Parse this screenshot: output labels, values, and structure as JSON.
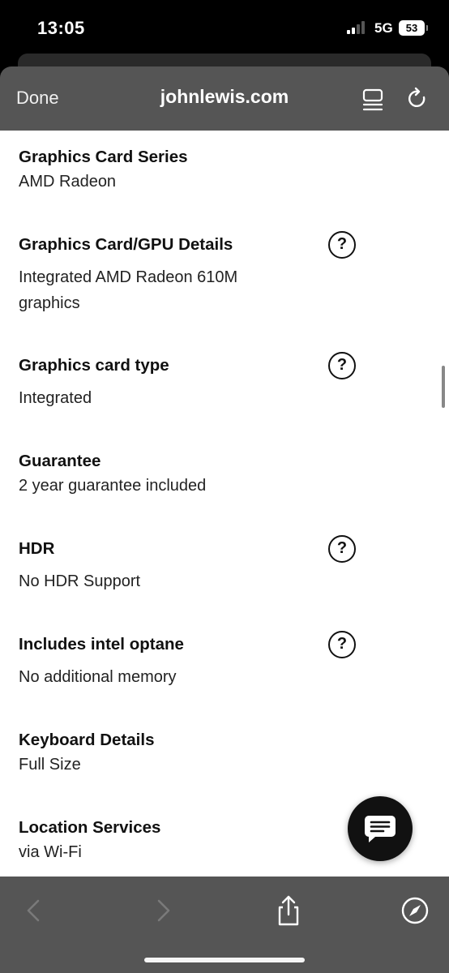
{
  "status_bar": {
    "time": "13:05",
    "network": "5G",
    "battery": "53"
  },
  "browser": {
    "done_label": "Done",
    "url": "johnlewis.com",
    "icons": {
      "reader": "reader-icon",
      "reload": "reload-icon"
    }
  },
  "specs": [
    {
      "title": "Graphics Card Series",
      "value": "AMD Radeon",
      "has_help": false
    },
    {
      "title": "Graphics Card/GPU Details",
      "value_lines": [
        "Integrated AMD Radeon 610M",
        "graphics"
      ],
      "has_help": true
    },
    {
      "title": "Graphics card type",
      "value": "Integrated",
      "has_help": true
    },
    {
      "title": "Guarantee",
      "value": "2 year guarantee included",
      "has_help": false
    },
    {
      "title": "HDR",
      "value": "No HDR Support",
      "has_help": true
    },
    {
      "title": "Includes intel optane",
      "value": "No additional memory",
      "has_help": true
    },
    {
      "title": "Keyboard Details",
      "value": "Full Size",
      "has_help": false
    },
    {
      "title": "Location Services",
      "value": "via Wi-Fi",
      "has_help": false
    }
  ],
  "help_symbol": "?",
  "toolbar": {
    "icons": [
      "back-icon",
      "forward-icon",
      "share-icon",
      "compass-icon"
    ]
  },
  "colors": {
    "chrome_gray": "#555555",
    "content_bg": "#ffffff",
    "text": "#111111"
  }
}
